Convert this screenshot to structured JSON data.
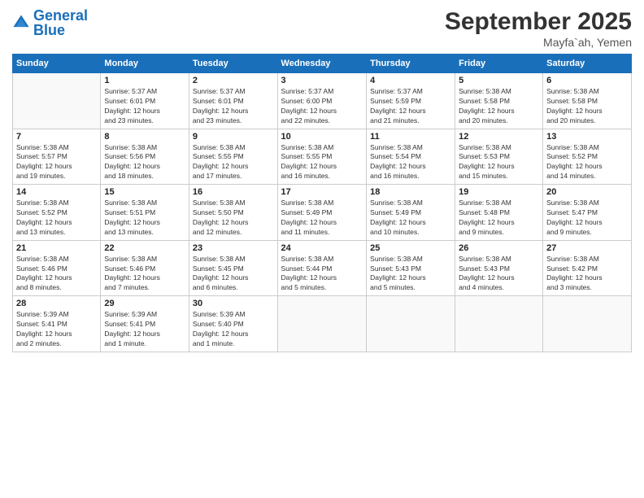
{
  "logo": {
    "line1": "General",
    "line2": "Blue"
  },
  "title": "September 2025",
  "subtitle": "Mayfa`ah, Yemen",
  "weekdays": [
    "Sunday",
    "Monday",
    "Tuesday",
    "Wednesday",
    "Thursday",
    "Friday",
    "Saturday"
  ],
  "weeks": [
    [
      {
        "day": "",
        "info": ""
      },
      {
        "day": "1",
        "info": "Sunrise: 5:37 AM\nSunset: 6:01 PM\nDaylight: 12 hours\nand 23 minutes."
      },
      {
        "day": "2",
        "info": "Sunrise: 5:37 AM\nSunset: 6:01 PM\nDaylight: 12 hours\nand 23 minutes."
      },
      {
        "day": "3",
        "info": "Sunrise: 5:37 AM\nSunset: 6:00 PM\nDaylight: 12 hours\nand 22 minutes."
      },
      {
        "day": "4",
        "info": "Sunrise: 5:37 AM\nSunset: 5:59 PM\nDaylight: 12 hours\nand 21 minutes."
      },
      {
        "day": "5",
        "info": "Sunrise: 5:38 AM\nSunset: 5:58 PM\nDaylight: 12 hours\nand 20 minutes."
      },
      {
        "day": "6",
        "info": "Sunrise: 5:38 AM\nSunset: 5:58 PM\nDaylight: 12 hours\nand 20 minutes."
      }
    ],
    [
      {
        "day": "7",
        "info": "Sunrise: 5:38 AM\nSunset: 5:57 PM\nDaylight: 12 hours\nand 19 minutes."
      },
      {
        "day": "8",
        "info": "Sunrise: 5:38 AM\nSunset: 5:56 PM\nDaylight: 12 hours\nand 18 minutes."
      },
      {
        "day": "9",
        "info": "Sunrise: 5:38 AM\nSunset: 5:55 PM\nDaylight: 12 hours\nand 17 minutes."
      },
      {
        "day": "10",
        "info": "Sunrise: 5:38 AM\nSunset: 5:55 PM\nDaylight: 12 hours\nand 16 minutes."
      },
      {
        "day": "11",
        "info": "Sunrise: 5:38 AM\nSunset: 5:54 PM\nDaylight: 12 hours\nand 16 minutes."
      },
      {
        "day": "12",
        "info": "Sunrise: 5:38 AM\nSunset: 5:53 PM\nDaylight: 12 hours\nand 15 minutes."
      },
      {
        "day": "13",
        "info": "Sunrise: 5:38 AM\nSunset: 5:52 PM\nDaylight: 12 hours\nand 14 minutes."
      }
    ],
    [
      {
        "day": "14",
        "info": "Sunrise: 5:38 AM\nSunset: 5:52 PM\nDaylight: 12 hours\nand 13 minutes."
      },
      {
        "day": "15",
        "info": "Sunrise: 5:38 AM\nSunset: 5:51 PM\nDaylight: 12 hours\nand 13 minutes."
      },
      {
        "day": "16",
        "info": "Sunrise: 5:38 AM\nSunset: 5:50 PM\nDaylight: 12 hours\nand 12 minutes."
      },
      {
        "day": "17",
        "info": "Sunrise: 5:38 AM\nSunset: 5:49 PM\nDaylight: 12 hours\nand 11 minutes."
      },
      {
        "day": "18",
        "info": "Sunrise: 5:38 AM\nSunset: 5:49 PM\nDaylight: 12 hours\nand 10 minutes."
      },
      {
        "day": "19",
        "info": "Sunrise: 5:38 AM\nSunset: 5:48 PM\nDaylight: 12 hours\nand 9 minutes."
      },
      {
        "day": "20",
        "info": "Sunrise: 5:38 AM\nSunset: 5:47 PM\nDaylight: 12 hours\nand 9 minutes."
      }
    ],
    [
      {
        "day": "21",
        "info": "Sunrise: 5:38 AM\nSunset: 5:46 PM\nDaylight: 12 hours\nand 8 minutes."
      },
      {
        "day": "22",
        "info": "Sunrise: 5:38 AM\nSunset: 5:46 PM\nDaylight: 12 hours\nand 7 minutes."
      },
      {
        "day": "23",
        "info": "Sunrise: 5:38 AM\nSunset: 5:45 PM\nDaylight: 12 hours\nand 6 minutes."
      },
      {
        "day": "24",
        "info": "Sunrise: 5:38 AM\nSunset: 5:44 PM\nDaylight: 12 hours\nand 5 minutes."
      },
      {
        "day": "25",
        "info": "Sunrise: 5:38 AM\nSunset: 5:43 PM\nDaylight: 12 hours\nand 5 minutes."
      },
      {
        "day": "26",
        "info": "Sunrise: 5:38 AM\nSunset: 5:43 PM\nDaylight: 12 hours\nand 4 minutes."
      },
      {
        "day": "27",
        "info": "Sunrise: 5:38 AM\nSunset: 5:42 PM\nDaylight: 12 hours\nand 3 minutes."
      }
    ],
    [
      {
        "day": "28",
        "info": "Sunrise: 5:39 AM\nSunset: 5:41 PM\nDaylight: 12 hours\nand 2 minutes."
      },
      {
        "day": "29",
        "info": "Sunrise: 5:39 AM\nSunset: 5:41 PM\nDaylight: 12 hours\nand 1 minute."
      },
      {
        "day": "30",
        "info": "Sunrise: 5:39 AM\nSunset: 5:40 PM\nDaylight: 12 hours\nand 1 minute."
      },
      {
        "day": "",
        "info": ""
      },
      {
        "day": "",
        "info": ""
      },
      {
        "day": "",
        "info": ""
      },
      {
        "day": "",
        "info": ""
      }
    ]
  ]
}
